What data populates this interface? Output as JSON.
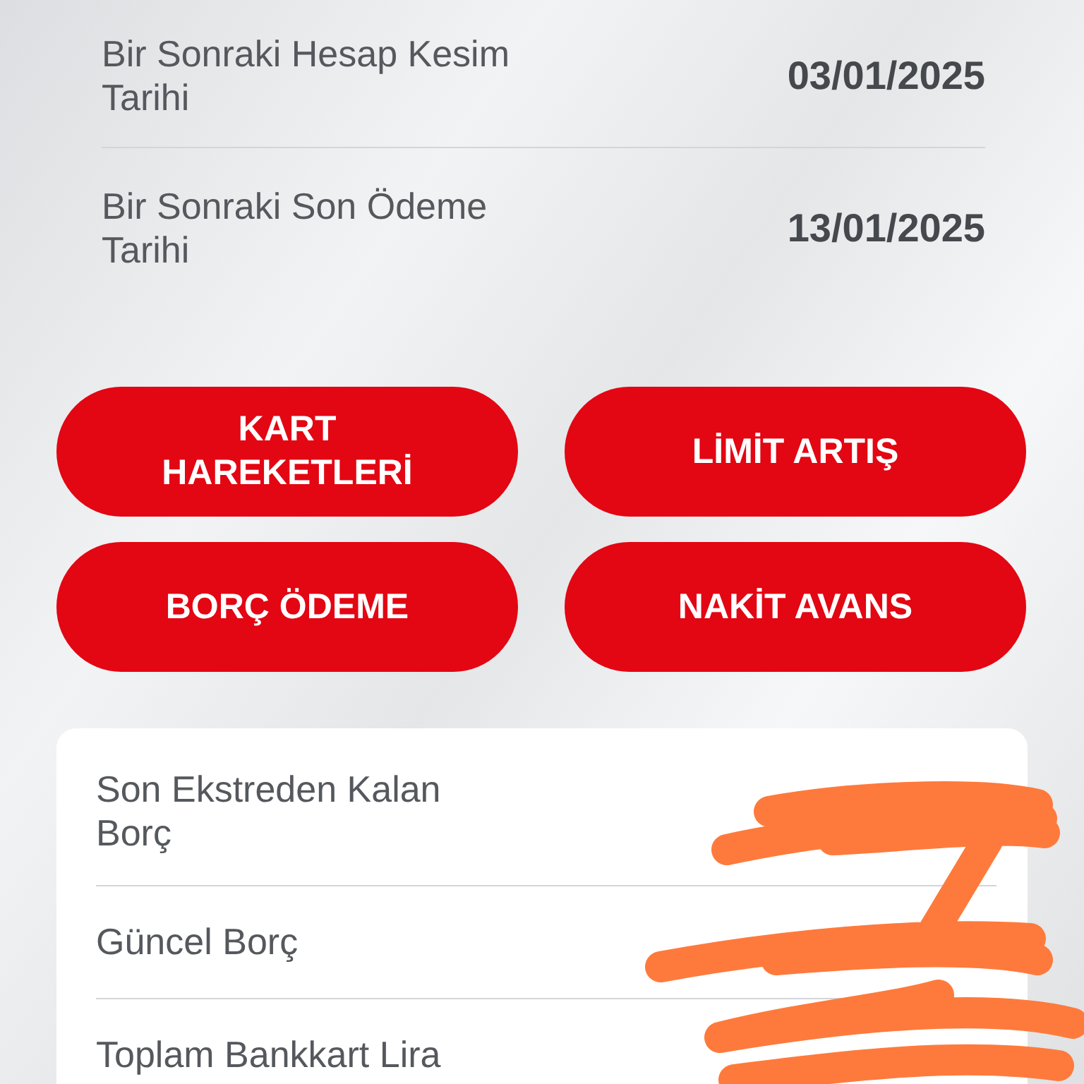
{
  "dates": [
    {
      "label": "Bir Sonraki Hesap Kesim Tarihi",
      "value": "03/01/2025"
    },
    {
      "label": "Bir Sonraki Son Ödeme Tarihi",
      "value": "13/01/2025"
    }
  ],
  "actions": [
    "KART HAREKETLERİ",
    "LİMİT ARTIŞ",
    "BORÇ ÖDEME",
    "NAKİT AVANS"
  ],
  "debts": [
    {
      "label": "Son Ekstreden Kalan Borç"
    },
    {
      "label": "Güncel Borç"
    },
    {
      "label": "Toplam Bankkart Lira"
    }
  ]
}
